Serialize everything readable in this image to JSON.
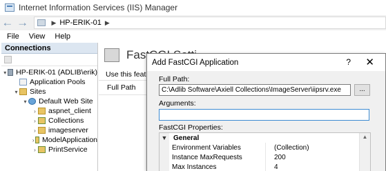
{
  "window": {
    "title": "Internet Information Services (IIS) Manager"
  },
  "address": {
    "path": "HP-ERIK-01"
  },
  "menu": [
    "File",
    "View",
    "Help"
  ],
  "connections": {
    "header": "Connections",
    "tree": [
      {
        "label": "HP-ERIK-01 (ADLIB\\erik)",
        "chevron": "▾",
        "icon": "server-icon"
      },
      {
        "label": "Application Pools",
        "chevron": "",
        "icon": "app-pool-icon"
      },
      {
        "label": "Sites",
        "chevron": "▾",
        "icon": "folder-icon"
      },
      {
        "label": "Default Web Site",
        "chevron": "▾",
        "icon": "globe-icon"
      },
      {
        "label": "aspnet_client",
        "chevron": "›",
        "icon": "folder-icon"
      },
      {
        "label": "Collections",
        "chevron": "›",
        "icon": "application-icon"
      },
      {
        "label": "imageserver",
        "chevron": "›",
        "icon": "folder-icon"
      },
      {
        "label": "ModelApplication",
        "chevron": "›",
        "icon": "application-icon"
      },
      {
        "label": "PrintService",
        "chevron": "›",
        "icon": "application-icon"
      }
    ]
  },
  "main": {
    "title": "FastCGI Setti",
    "description": "Use this feature",
    "column": "Full Path"
  },
  "dialog": {
    "title": "Add FastCGI Application",
    "help": "?",
    "close": "✕",
    "full_path_label": "Full Path:",
    "full_path_value": "C:\\Adlib Software\\Axiell Collections\\ImageServer\\iipsrv.exe",
    "browse_label": "...",
    "arguments_label": "Arguments:",
    "arguments_value": "",
    "properties_label": "FastCGI Properties:",
    "category": "General",
    "properties": [
      {
        "name": "Environment Variables",
        "value": "(Collection)"
      },
      {
        "name": "Instance MaxRequests",
        "value": "200"
      },
      {
        "name": "Max Instances",
        "value": "4"
      }
    ]
  }
}
